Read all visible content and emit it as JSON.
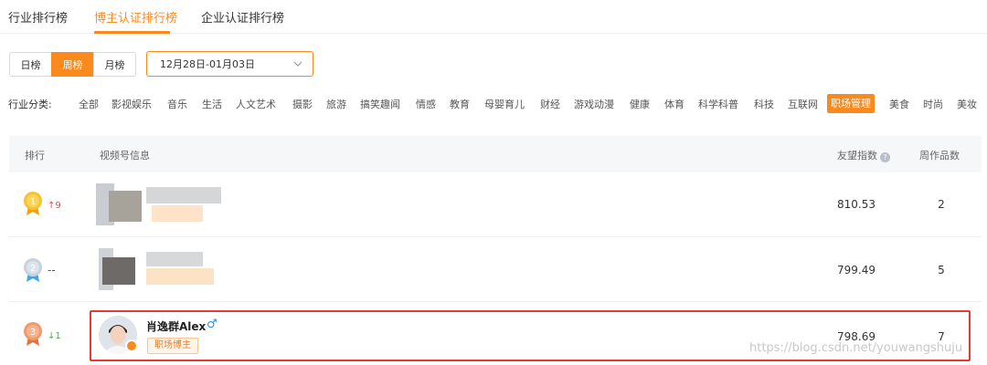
{
  "tabs": [
    "行业排行榜",
    "博主认证排行榜",
    "企业认证排行榜"
  ],
  "period": {
    "options": [
      "日榜",
      "周榜",
      "月榜"
    ],
    "active": "周榜"
  },
  "date_range": "12月28日-01月03日",
  "category": {
    "label": "行业分类:",
    "items": [
      "全部",
      "影视娱乐",
      "音乐",
      "生活",
      "人文艺术",
      "摄影",
      "旅游",
      "搞笑趣闻",
      "情感",
      "教育",
      "母婴育儿",
      "财经",
      "游戏动漫",
      "健康",
      "体育",
      "科学科普",
      "科技",
      "互联网",
      "职场管理",
      "美食",
      "时尚",
      "美妆"
    ],
    "active": "职场管理"
  },
  "table": {
    "headers": {
      "rank": "排行",
      "info": "视频号信息",
      "index": "友望指数",
      "works": "周作品数"
    },
    "rows": [
      {
        "rank": "1",
        "trend": "↑9",
        "index": "810.53",
        "works": "2"
      },
      {
        "rank": "2",
        "trend": "--",
        "index": "799.49",
        "works": "5"
      },
      {
        "rank": "3",
        "trend": "↓1",
        "index": "798.69",
        "works": "7",
        "name": "肖逸群Alex",
        "tag": "职场博主"
      }
    ]
  },
  "watermark": "https://blog.csdn.net/youwangshuju",
  "colors": {
    "accent": "#fa8a1e",
    "highlight": "#e53935"
  }
}
